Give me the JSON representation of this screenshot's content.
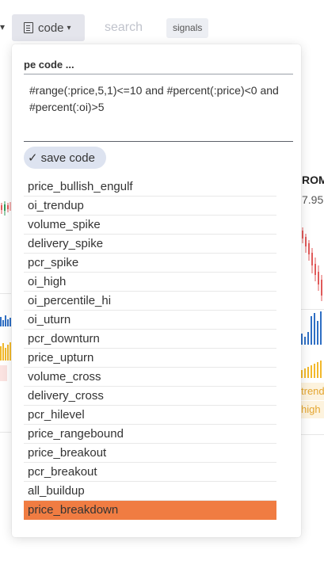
{
  "header": {
    "prev_caret": "▾",
    "code_label": "code",
    "search_label": "search",
    "signals_label": "signals"
  },
  "background": {
    "right_title": "ROMC",
    "right_price": "7.95",
    "tag_trend": "trend",
    "tag_high": "high"
  },
  "panel": {
    "title": "pe code ...",
    "code_text": "#range(:price,5,1)<=10 and #percent(:price)<0 and #percent(:oi)>5",
    "save_label": "save code",
    "items": [
      {
        "label": "price_bullish_engulf"
      },
      {
        "label": "oi_trendup"
      },
      {
        "label": "volume_spike"
      },
      {
        "label": "delivery_spike"
      },
      {
        "label": "pcr_spike"
      },
      {
        "label": "oi_high"
      },
      {
        "label": "oi_percentile_hi"
      },
      {
        "label": "oi_uturn"
      },
      {
        "label": "pcr_downturn"
      },
      {
        "label": "price_upturn"
      },
      {
        "label": "volume_cross"
      },
      {
        "label": "delivery_cross"
      },
      {
        "label": "pcr_hilevel"
      },
      {
        "label": "price_rangebound"
      },
      {
        "label": "price_breakout"
      },
      {
        "label": "pcr_breakout"
      },
      {
        "label": "all_buildup"
      },
      {
        "label": "price_breakdown",
        "selected": true
      }
    ]
  },
  "colors": {
    "selected": "#f07c42",
    "candle_up": "#2e9c5a",
    "candle_down": "#e05a5a",
    "volume_blue": "#2f6fc4",
    "volume_yellow": "#f2b92c"
  }
}
